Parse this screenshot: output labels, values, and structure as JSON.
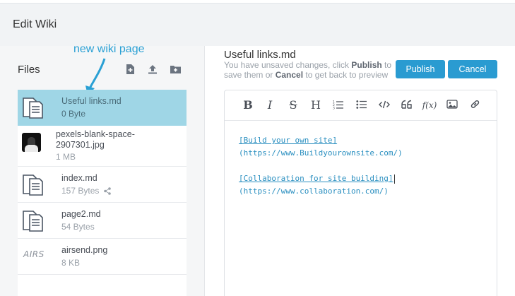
{
  "modal": {
    "title": "Edit Wiki"
  },
  "annotation": {
    "text": "new wiki page"
  },
  "files": {
    "title": "Files",
    "toolbar": [
      "new-file-icon",
      "upload-icon",
      "new-folder-icon"
    ],
    "items": [
      {
        "name": "Useful links.md",
        "size": "0 Byte",
        "type": "document",
        "selected": true
      },
      {
        "name": "pexels-blank-space-2907301.jpg",
        "size": "1 MB",
        "type": "image"
      },
      {
        "name": "index.md",
        "size": "157 Bytes",
        "type": "document",
        "shared": true
      },
      {
        "name": "page2.md",
        "size": "54 Bytes",
        "type": "document"
      },
      {
        "name": "airsend.png",
        "size": "8 KB",
        "type": "image-airs",
        "thumb_text": "AIRS"
      }
    ]
  },
  "editor": {
    "doc_title": "Useful links.md",
    "notice": {
      "part1": "You have unsaved changes, click ",
      "publish_word": "Publish",
      "part2": " to save them or ",
      "cancel_word": "Cancel",
      "part3": " to get back to preview"
    },
    "publish_label": "Publish",
    "cancel_label": "Cancel",
    "toolbar": [
      "B",
      "I",
      "S",
      "H",
      "ordered-list",
      "bullet-list",
      "code",
      "quote",
      "f(x)",
      "image",
      "link"
    ],
    "content": {
      "line1": "[Build your own site]",
      "line2": "(https://www.Buildyourownsite.com/)",
      "line3": "[Collaboration for site building]",
      "line4": "(https://www.collaboration.com/)"
    }
  }
}
